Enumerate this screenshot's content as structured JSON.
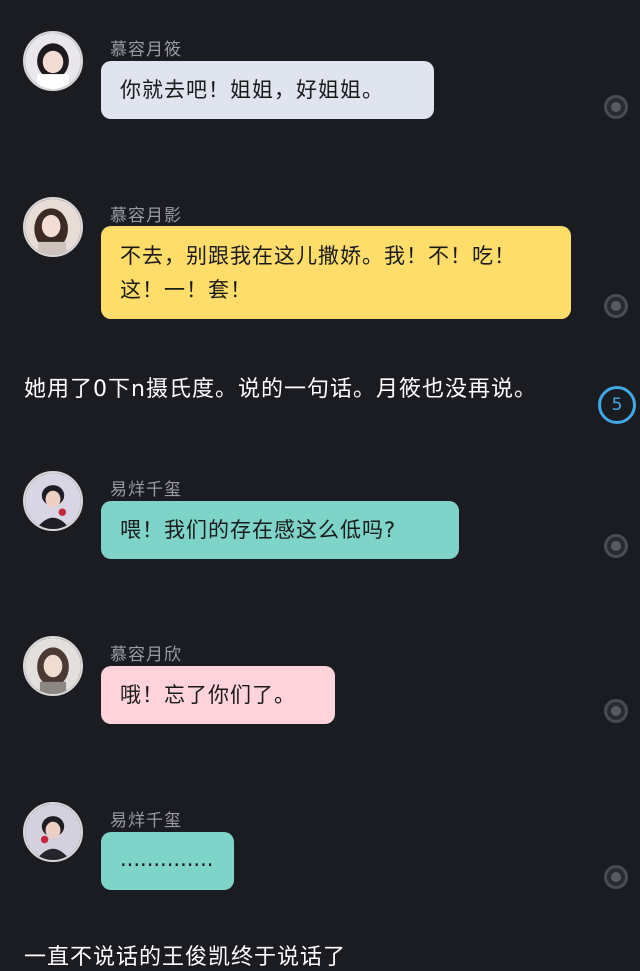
{
  "colors": {
    "background": "#1b1c22",
    "bubble_gray": "#dfe4ee",
    "bubble_yellow": "#ffdd6b",
    "bubble_teal": "#7fd4c9",
    "bubble_pink": "#ffd3dc",
    "badge_blue": "#3fa9e8"
  },
  "messages": [
    {
      "name": "慕容月筱",
      "text": "你就去吧！姐姐，好姐姐。",
      "bubble_color": "#dfe4ee",
      "avatar_icon": "girl-avatar-icon"
    },
    {
      "name": "慕容月影",
      "text": "不去，别跟我在这儿撒娇。我！不！吃！这！一！套！",
      "bubble_color": "#ffdd6b",
      "avatar_icon": "girl-avatar-icon"
    },
    {
      "name": "易烊千玺",
      "text": "喂！我们的存在感这么低吗?",
      "bubble_color": "#7fd4c9",
      "avatar_icon": "boy-avatar-icon"
    },
    {
      "name": "慕容月欣",
      "text": "哦！忘了你们了。",
      "bubble_color": "#ffd3dc",
      "avatar_icon": "girl-avatar-icon"
    },
    {
      "name": "易烊千玺",
      "text": "..............",
      "bubble_color": "#7fd4c9",
      "avatar_icon": "boy-avatar-icon"
    }
  ],
  "narrations": [
    "她用了0下n摄氏度。说的一句话。月筱也没再说。",
    "一直不说话的王俊凯终于说话了"
  ],
  "count_badge": "5"
}
